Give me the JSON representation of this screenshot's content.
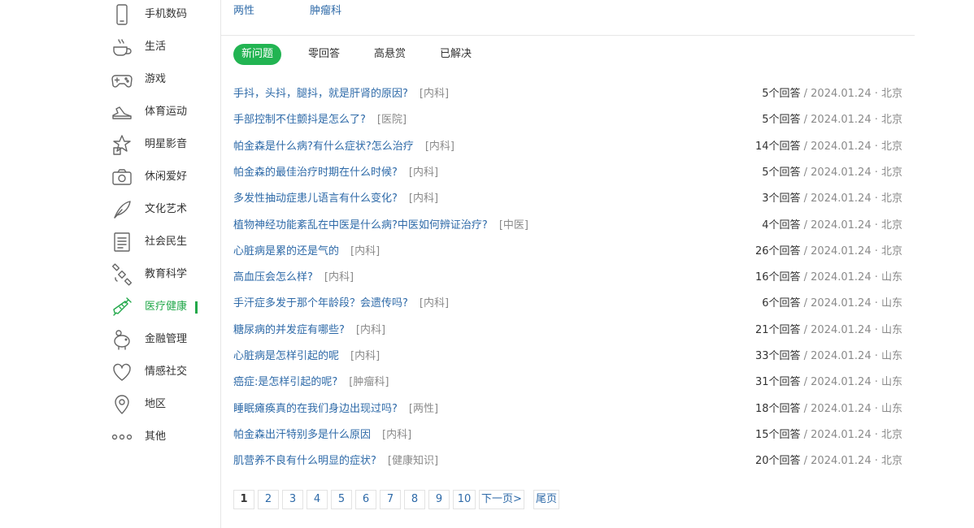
{
  "sidebar": {
    "items": [
      {
        "label": "手机数码",
        "icon": "phone-icon",
        "active": false
      },
      {
        "label": "生活",
        "icon": "coffee-cup-icon",
        "active": false
      },
      {
        "label": "游戏",
        "icon": "gamepad-icon",
        "active": false
      },
      {
        "label": "体育运动",
        "icon": "sneaker-icon",
        "active": false
      },
      {
        "label": "明星影音",
        "icon": "star-icon",
        "active": false
      },
      {
        "label": "休闲爱好",
        "icon": "camera-icon",
        "active": false
      },
      {
        "label": "文化艺术",
        "icon": "feather-pen-icon",
        "active": false
      },
      {
        "label": "社会民生",
        "icon": "document-icon",
        "active": false
      },
      {
        "label": "教育科学",
        "icon": "satellite-icon",
        "active": false
      },
      {
        "label": "医疗健康",
        "icon": "syringe-icon",
        "active": true
      },
      {
        "label": "金融管理",
        "icon": "piggy-bank-icon",
        "active": false
      },
      {
        "label": "情感社交",
        "icon": "heart-icon",
        "active": false
      },
      {
        "label": "地区",
        "icon": "location-pin-icon",
        "active": false
      },
      {
        "label": "其他",
        "icon": "more-dots-icon",
        "active": false
      }
    ],
    "accent_color": "#22a84a"
  },
  "sublinks": [
    "两性",
    "肿瘤科"
  ],
  "tabs": [
    {
      "label": "新问题",
      "active": true
    },
    {
      "label": "零回答",
      "active": false
    },
    {
      "label": "高悬赏",
      "active": false
    },
    {
      "label": "已解决",
      "active": false
    }
  ],
  "questions": [
    {
      "title": "手抖，头抖，腿抖，就是肝肾的原因?",
      "tag": "[内科]",
      "answers": "5个回答",
      "sep": "/",
      "date": "2024.01.24 · 北京"
    },
    {
      "title": "手部控制不住颤抖是怎么了?",
      "tag": "[医院]",
      "answers": "5个回答",
      "sep": "/",
      "date": "2024.01.24 · 北京"
    },
    {
      "title": "帕金森是什么病?有什么症状?怎么治疗",
      "tag": "[内科]",
      "answers": "14个回答",
      "sep": "/",
      "date": "2024.01.24 · 北京"
    },
    {
      "title": "帕金森的最佳治疗时期在什么时候?",
      "tag": "[内科]",
      "answers": "5个回答",
      "sep": "/",
      "date": "2024.01.24 · 北京"
    },
    {
      "title": "多发性抽动症患儿语言有什么变化?",
      "tag": "[内科]",
      "answers": "3个回答",
      "sep": "/",
      "date": "2024.01.24 · 北京"
    },
    {
      "title": "植物神经功能紊乱在中医是什么病?中医如何辨证治疗?",
      "tag": "[中医]",
      "answers": "4个回答",
      "sep": "/",
      "date": "2024.01.24 · 北京"
    },
    {
      "title": "心脏病是累的还是气的",
      "tag": "[内科]",
      "answers": "26个回答",
      "sep": "/",
      "date": "2024.01.24 · 北京"
    },
    {
      "title": "高血压会怎么样?",
      "tag": "[内科]",
      "answers": "16个回答",
      "sep": "/",
      "date": "2024.01.24 · 山东"
    },
    {
      "title": "手汗症多发于那个年龄段？会遗传吗?",
      "tag": "[内科]",
      "answers": "6个回答",
      "sep": "/",
      "date": "2024.01.24 · 山东"
    },
    {
      "title": "糖尿病的并发症有哪些?",
      "tag": "[内科]",
      "answers": "21个回答",
      "sep": "/",
      "date": "2024.01.24 · 山东"
    },
    {
      "title": "心脏病是怎样引起的呢",
      "tag": "[内科]",
      "answers": "33个回答",
      "sep": "/",
      "date": "2024.01.24 · 山东"
    },
    {
      "title": "癌症:是怎样引起的呢?",
      "tag": "[肿瘤科]",
      "answers": "31个回答",
      "sep": "/",
      "date": "2024.01.24 · 山东"
    },
    {
      "title": "睡眠瘫痪真的在我们身边出现过吗?",
      "tag": "[两性]",
      "answers": "18个回答",
      "sep": "/",
      "date": "2024.01.24 · 山东"
    },
    {
      "title": "帕金森出汗特别多是什么原因",
      "tag": "[内科]",
      "answers": "15个回答",
      "sep": "/",
      "date": "2024.01.24 · 北京"
    },
    {
      "title": "肌营养不良有什么明显的症状?",
      "tag": "[健康知识]",
      "answers": "20个回答",
      "sep": "/",
      "date": "2024.01.24 · 北京"
    }
  ],
  "pagination": {
    "pages": [
      "1",
      "2",
      "3",
      "4",
      "5",
      "6",
      "7",
      "8",
      "9",
      "10"
    ],
    "current": "1",
    "next": "下一页>",
    "last": "尾页"
  }
}
